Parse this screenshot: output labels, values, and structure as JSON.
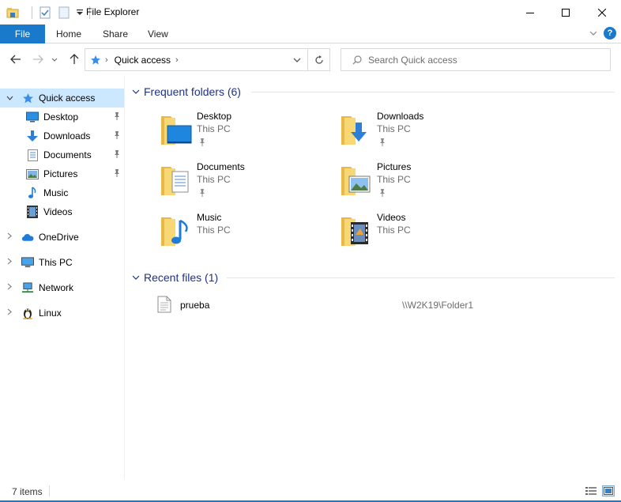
{
  "window": {
    "title": "File Explorer",
    "controls": {
      "minimize_icon": "minimize-icon",
      "maximize_icon": "maximize-icon",
      "close_icon": "close-icon"
    }
  },
  "ribbon": {
    "tabs": [
      {
        "label": "File"
      },
      {
        "label": "Home"
      },
      {
        "label": "Share"
      },
      {
        "label": "View"
      }
    ],
    "help_label": "?"
  },
  "nav": {
    "address_root_icon": "quick-access-star-icon",
    "address_crumb": "Quick access",
    "search_placeholder": "Search Quick access"
  },
  "sidebar": {
    "items": [
      {
        "label": "Quick access",
        "icon": "star-icon",
        "pinned": false,
        "selected": true
      },
      {
        "label": "Desktop",
        "icon": "desktop-icon",
        "pinned": true
      },
      {
        "label": "Downloads",
        "icon": "downloads-icon",
        "pinned": true
      },
      {
        "label": "Documents",
        "icon": "documents-icon",
        "pinned": true
      },
      {
        "label": "Pictures",
        "icon": "pictures-icon",
        "pinned": true
      },
      {
        "label": "Music",
        "icon": "music-icon",
        "pinned": false
      },
      {
        "label": "Videos",
        "icon": "videos-icon",
        "pinned": false
      },
      {
        "label": "OneDrive",
        "icon": "onedrive-icon",
        "pinned": false
      },
      {
        "label": "This PC",
        "icon": "this-pc-icon",
        "pinned": false
      },
      {
        "label": "Network",
        "icon": "network-icon",
        "pinned": false
      },
      {
        "label": "Linux",
        "icon": "linux-icon",
        "pinned": false
      }
    ]
  },
  "content": {
    "frequent_header": "Frequent folders (6)",
    "folders": [
      {
        "name": "Desktop",
        "location": "This PC",
        "pinned": true
      },
      {
        "name": "Downloads",
        "location": "This PC",
        "pinned": true
      },
      {
        "name": "Documents",
        "location": "This PC",
        "pinned": true
      },
      {
        "name": "Pictures",
        "location": "This PC",
        "pinned": true
      },
      {
        "name": "Music",
        "location": "This PC",
        "pinned": false
      },
      {
        "name": "Videos",
        "location": "This PC",
        "pinned": false
      }
    ],
    "recent_header": "Recent files (1)",
    "recent_files": [
      {
        "name": "prueba",
        "path": "\\\\W2K19\\Folder1"
      }
    ]
  },
  "status": {
    "item_count": "7 items"
  },
  "colors": {
    "accent": "#1979ca",
    "selection": "#cce8ff",
    "group_header": "#1e3287",
    "folder_yellow": "#f8d775"
  }
}
